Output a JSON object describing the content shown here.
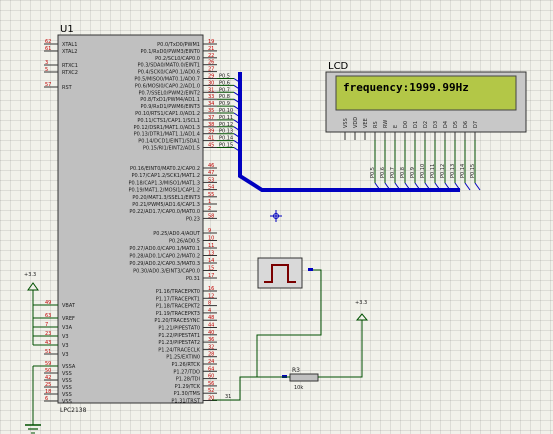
{
  "mcu": {
    "ref": "U1",
    "part": "LPC2138",
    "left_pins": [
      {
        "num": "62",
        "name": "XTAL1"
      },
      {
        "num": "61",
        "name": "XTAL2"
      },
      {
        "num": "3",
        "name": "RTXC1"
      },
      {
        "num": "5",
        "name": "RTXC2"
      },
      {
        "num": "57",
        "name": "RST"
      }
    ],
    "power_pins": [
      {
        "num": "49",
        "name": "VBAT"
      },
      {
        "num": "63",
        "name": "VREF"
      },
      {
        "num": "7",
        "name": "V3A"
      },
      {
        "num": "23",
        "name": "V3"
      },
      {
        "num": "43",
        "name": "V3"
      },
      {
        "num": "51",
        "name": "V3"
      },
      {
        "num": "59",
        "name": "VSSA"
      },
      {
        "num": "50",
        "name": "VSS"
      },
      {
        "num": "42",
        "name": "VSS"
      },
      {
        "num": "25",
        "name": "VSS"
      },
      {
        "num": "18",
        "name": "VSS"
      },
      {
        "num": "6",
        "name": "VSS"
      }
    ],
    "right_pins_a": [
      {
        "num": "19",
        "name": "P0.0/TxD0/PWM1"
      },
      {
        "num": "21",
        "name": "P0.1/RxD0/PWM3/EINT0"
      },
      {
        "num": "22",
        "name": "P0.2/SCL0/CAP0.0"
      },
      {
        "num": "26",
        "name": "P0.3/SDA0/MAT0.0/EINT1"
      },
      {
        "num": "27",
        "name": "P0.4/SCK0/CAP0.1/AD0.6"
      },
      {
        "num": "29",
        "name": "P0.5/MISO0/MAT0.1/AD0.7"
      },
      {
        "num": "30",
        "name": "P0.6/MOSI0/CAP0.2/AD1.0"
      },
      {
        "num": "31",
        "name": "P0.7/SSEL0/PWM2/EINT2"
      },
      {
        "num": "33",
        "name": "P0.8/TxD1/PWM4/AD1.1"
      },
      {
        "num": "34",
        "name": "P0.9/RxD1/PWM6/EINT3"
      },
      {
        "num": "35",
        "name": "P0.10/RTS1/CAP1.0/AD1.2"
      },
      {
        "num": "37",
        "name": "P0.11/CTS1/CAP1.1/SCL1"
      },
      {
        "num": "38",
        "name": "P0.12/DSR1/MAT1.0/AD1.3"
      },
      {
        "num": "39",
        "name": "P0.13/DTR1/MAT1.1/AD1.4"
      },
      {
        "num": "41",
        "name": "P0.14/DCD1/EINT1/SDA1"
      },
      {
        "num": "45",
        "name": "P0.15/RI1/EINT2/AD1.5"
      }
    ],
    "right_pins_b": [
      {
        "num": "46",
        "name": "P0.16/EINT0/MAT0.2/CAP0.2"
      },
      {
        "num": "47",
        "name": "P0.17/CAP1.2/SCK1/MAT1.2"
      },
      {
        "num": "53",
        "name": "P0.18/CAP1.3/MISO1/MAT1.3"
      },
      {
        "num": "54",
        "name": "P0.19/MAT1.2/MOSI1/CAP1.2"
      },
      {
        "num": "55",
        "name": "P0.20/MAT1.3/SSEL1/EINT3"
      },
      {
        "num": "1",
        "name": "P0.21/PWM5/AD1.6/CAP1.3"
      },
      {
        "num": "2",
        "name": "P0.22/AD1.7/CAP0.0/MAT0.0"
      },
      {
        "num": "58",
        "name": "P0.23"
      }
    ],
    "right_pins_c": [
      {
        "num": "9",
        "name": "P0.25/AD0.4/AOUT"
      },
      {
        "num": "10",
        "name": "P0.26/AD0.5"
      },
      {
        "num": "11",
        "name": "P0.27/AD0.0/CAP0.1/MAT0.1"
      },
      {
        "num": "13",
        "name": "P0.28/AD0.1/CAP0.2/MAT0.2"
      },
      {
        "num": "14",
        "name": "P0.29/AD0.2/CAP0.3/MAT0.3"
      },
      {
        "num": "15",
        "name": "P0.30/AD0.3/EINT3/CAP0.0"
      },
      {
        "num": "17",
        "name": "P0.31"
      }
    ],
    "right_pins_d": [
      {
        "num": "16",
        "name": "P1.16/TRACEPKT0"
      },
      {
        "num": "12",
        "name": "P1.17/TRACEPKT1"
      },
      {
        "num": "8",
        "name": "P1.18/TRACEPKT2"
      },
      {
        "num": "4",
        "name": "P1.19/TRACEPKT3"
      },
      {
        "num": "48",
        "name": "P1.20/TRACESYNC"
      },
      {
        "num": "44",
        "name": "P1.21/PIPESTAT0"
      },
      {
        "num": "40",
        "name": "P1.22/PIPESTAT1"
      },
      {
        "num": "36",
        "name": "P1.23/PIPESTAT2"
      },
      {
        "num": "32",
        "name": "P1.24/TRACECLK"
      },
      {
        "num": "28",
        "name": "P1.25/EXTIN0"
      },
      {
        "num": "24",
        "name": "P1.26/RTCK"
      },
      {
        "num": "64",
        "name": "P1.27/TDO"
      },
      {
        "num": "60",
        "name": "P1.28/TDI"
      },
      {
        "num": "56",
        "name": "P1.29/TCK"
      },
      {
        "num": "52",
        "name": "P1.30/TMS"
      },
      {
        "num": "20",
        "name": "P1.31/TRST"
      }
    ],
    "net_labels_a": [
      "P0.5",
      "P0.6",
      "P0.7",
      "P0.8",
      "P0.9",
      "P0.10",
      "P0.11",
      "P0.12",
      "P0.13",
      "P0.14",
      "P0.15"
    ]
  },
  "lcd": {
    "label": "LCD",
    "display_text": "frequency:1999.99Hz",
    "pins": [
      "VSS",
      "VDD",
      "VEE",
      "RS",
      "RW",
      "E",
      "D0",
      "D1",
      "D2",
      "D3",
      "D4",
      "D5",
      "D6",
      "D7"
    ],
    "net_labels": [
      "P0.5",
      "P0.6",
      "P0.7",
      "P0.8",
      "P0.9",
      "P0.10",
      "P0.11",
      "P0.12",
      "P0.13",
      "P0.14",
      "P0.15"
    ],
    "screen_color": "#b3c747"
  },
  "power_label": "+3.3",
  "resistor": {
    "ref": "R3",
    "value": "10k"
  },
  "wire_number": "31",
  "colors": {
    "wire": "#005000",
    "bus": "#0000c0",
    "pin": "#c00000",
    "part_body": "#c0c0c0"
  }
}
